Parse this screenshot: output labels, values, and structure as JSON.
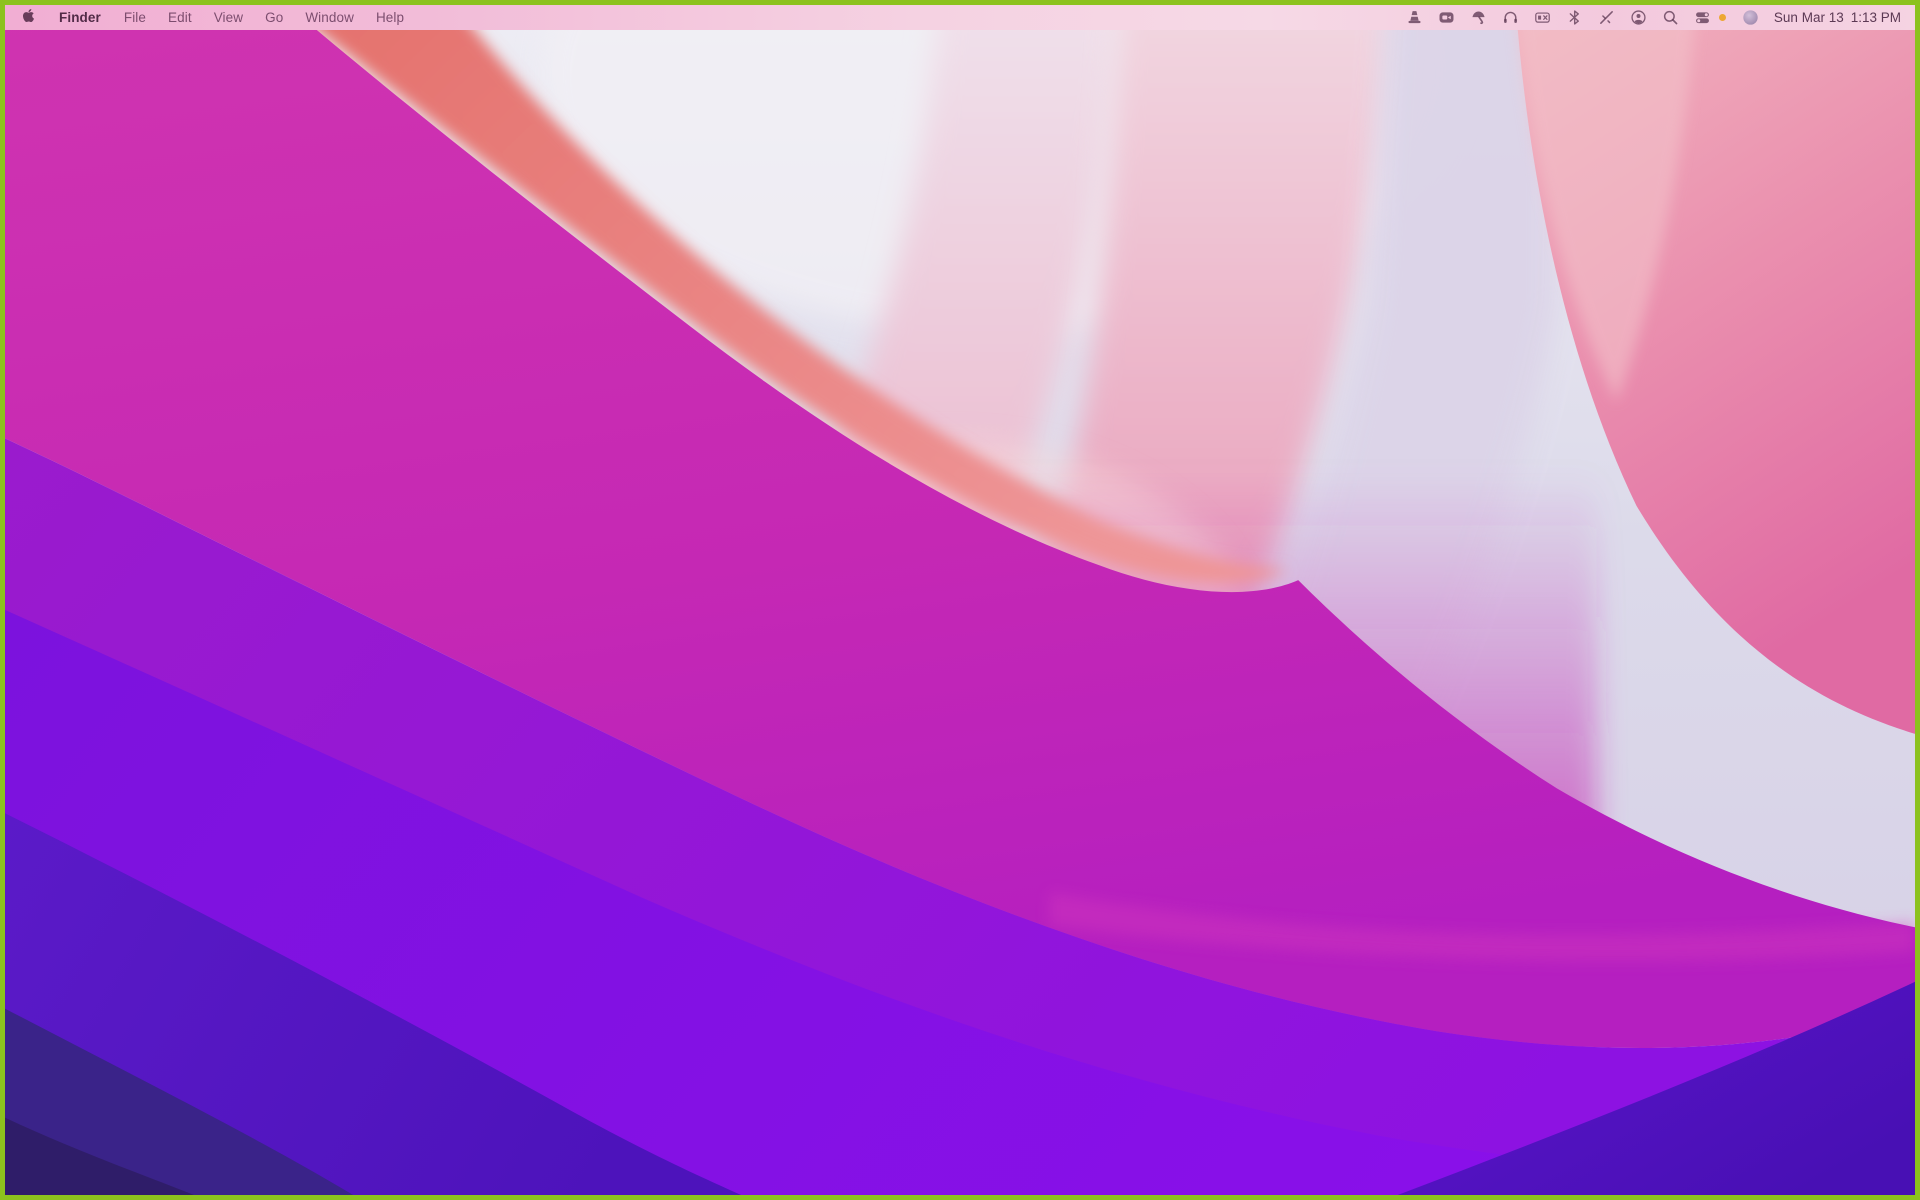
{
  "frame": {
    "border_color": "#8cc21e"
  },
  "menu_bar": {
    "app_name": "Finder",
    "menus": [
      "File",
      "Edit",
      "View",
      "Go",
      "Window",
      "Help"
    ],
    "status_icons": [
      "vlc-cone-icon",
      "screen-recorder-icon",
      "umbrella-antivirus-icon",
      "headphones-icon",
      "input-source-icon",
      "bluetooth-icon",
      "wifi-off-icon",
      "fast-user-switching-icon",
      "spotlight-search-icon",
      "control-center-icon",
      "recording-indicator-dot",
      "siri-icon"
    ],
    "recording_dot_color": "#eda733",
    "clock": {
      "date": "Sun Mar 13",
      "time": "1:13 PM"
    }
  },
  "desktop": {
    "wallpaper_name": "macOS Monterey abstract layered waves",
    "colors": {
      "lavender_valley": "#dcdaea",
      "canyon_pink_light": "#f2dae5",
      "canyon_pink": "#e795b6",
      "salmon_ridge": "#e5716d",
      "mountain_pink_top": "#f2b6c0",
      "mountain_pink_bottom": "#e06aa3",
      "magenta": "#cb2cb0",
      "purple_magenta": "#9a1bcd",
      "vivid_purple": "#7c12dd",
      "blue_purple": "#5b1ac8",
      "indigo": "#3a2389",
      "deep_indigo": "#2f1d66"
    }
  }
}
